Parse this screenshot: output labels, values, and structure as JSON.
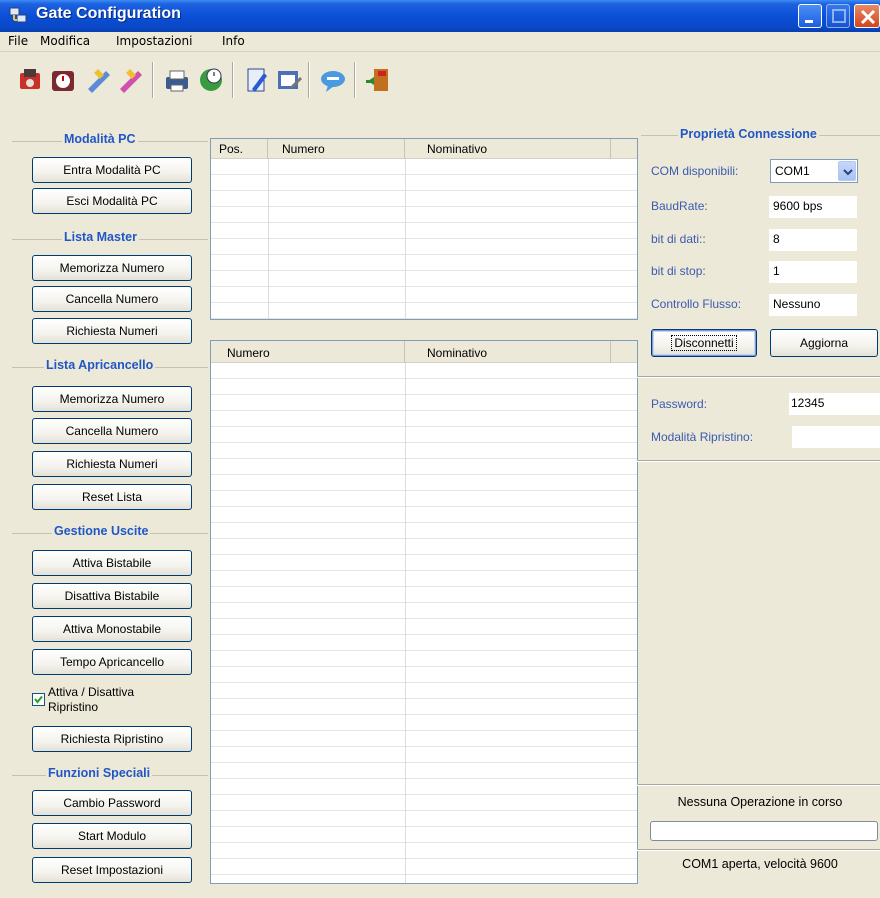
{
  "window": {
    "title": "Gate Configuration"
  },
  "menu": [
    "File",
    "Modifica",
    "Impostazioni",
    "Info"
  ],
  "toolbar": {
    "icons": [
      "phone-connect-icon",
      "alarm-clock-icon",
      "wrench-blue-icon",
      "wrench-pink-icon",
      "printer-icon",
      "globe-clock-icon",
      "edit-note-icon",
      "edit-window-icon",
      "chat-bubble-icon",
      "exit-door-icon"
    ]
  },
  "left": {
    "pc": {
      "title": "Modalità PC",
      "enter": "Entra Modalità PC",
      "exit": "Esci Modalità PC"
    },
    "master": {
      "title": "Lista Master",
      "store": "Memorizza Numero",
      "delete": "Cancella Numero",
      "request": "Richiesta Numeri"
    },
    "opener": {
      "title": "Lista Apricancello",
      "store": "Memorizza Numero",
      "delete": "Cancella Numero",
      "request": "Richiesta Numeri",
      "reset": "Reset Lista"
    },
    "outputs": {
      "title": "Gestione Uscite",
      "bistable_on": "Attiva Bistabile",
      "bistable_off": "Disattiva Bistabile",
      "monostable_on": "Attiva Monostabile",
      "opener_time": "Tempo Apricancello",
      "restore_toggle_line1": "Attiva / Disattiva",
      "restore_toggle_line2": "Ripristino",
      "restore_toggle_checked": true,
      "restore_request": "Richiesta Ripristino"
    },
    "special": {
      "title": "Funzioni Speciali",
      "password": "Cambio Password",
      "start": "Start Modulo",
      "reset": "Reset Impostazioni"
    }
  },
  "master_grid": {
    "columns": [
      "Pos.",
      "Numero",
      "Nominativo"
    ]
  },
  "opener_grid": {
    "columns": [
      "Numero",
      "Nominativo"
    ]
  },
  "connection": {
    "title": "Proprietà Connessione",
    "com_label": "COM disponibili:",
    "com_value": "COM1",
    "baud_label": "BaudRate:",
    "baud_value": "9600 bps",
    "databits_label": "bit di dati::",
    "databits_value": "8",
    "stopbits_label": "bit di stop:",
    "stopbits_value": "1",
    "flow_label": "Controllo Flusso:",
    "flow_value": "Nessuno",
    "disconnect": "Disconnetti",
    "refresh": "Aggiorna"
  },
  "device": {
    "password_label": "Password:",
    "password_value": "12345",
    "restore_label": "Modalità Ripristino:",
    "restore_value": ""
  },
  "status": {
    "operation": "Nessuna Operazione in corso",
    "progress": 0,
    "port": "COM1 aperta, velocità 9600"
  }
}
